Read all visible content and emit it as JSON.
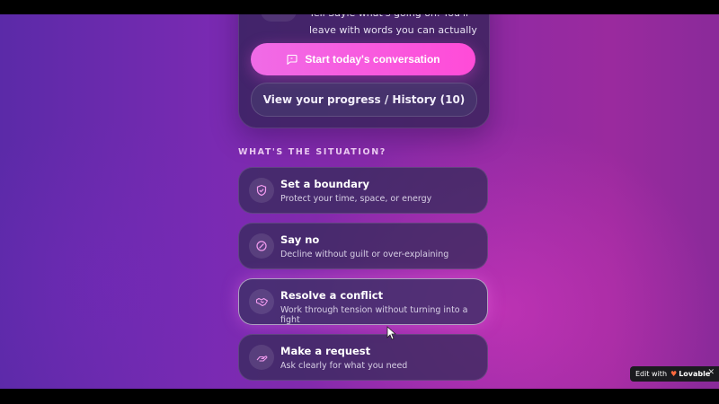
{
  "hero": {
    "description": "Tell Sayle what's going on. You'll leave with words you can actually use.",
    "primary_button": "Start today's conversation",
    "secondary_button": "View your progress / History (10)"
  },
  "section": {
    "heading": "WHAT'S THE SITUATION?"
  },
  "options": [
    {
      "title": "Set a boundary",
      "subtitle": "Protect your time, space, or energy",
      "icon": "shield-icon"
    },
    {
      "title": "Say no",
      "subtitle": "Decline without guilt or over-explaining",
      "icon": "no-icon"
    },
    {
      "title": "Resolve a conflict",
      "subtitle": "Work through tension without turning into a fight",
      "icon": "handshake-icon"
    },
    {
      "title": "Make a request",
      "subtitle": "Ask clearly for what you need",
      "icon": "hand-icon"
    }
  ],
  "badge": {
    "prefix": "Edit with",
    "brand": "Lovable",
    "close": "✕"
  },
  "colors": {
    "accent": "#f06be6",
    "icon_stroke": "#f39cf0"
  }
}
